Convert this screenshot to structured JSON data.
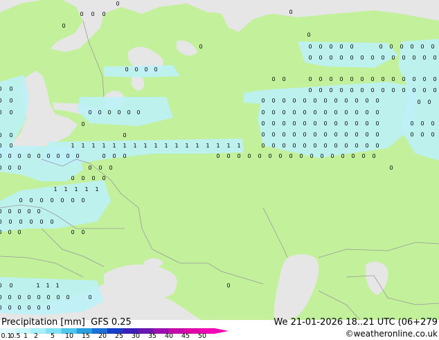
{
  "map": {
    "region": "Eastern Europe / Western Russia",
    "colors": {
      "land": "#c3f09a",
      "sea": "#e6e6e6",
      "border": "#9a9a9a",
      "precip_light": "#bdf1f7",
      "dot_outline": "#3a3a3a"
    },
    "precip_value_labels": [
      "0",
      "1"
    ]
  },
  "legend": {
    "title": "Precipitation [mm]",
    "model": "GFS 0.25",
    "valid_time": "We 21-01-2026 18..21 UTC (06+279",
    "credit": "©weatheronline.co.uk",
    "scale_values": [
      "0.1",
      "0.5",
      "1",
      "2",
      "5",
      "10",
      "15",
      "20",
      "25",
      "30",
      "35",
      "40",
      "45",
      "50"
    ],
    "scale_colors": [
      "#dffbff",
      "#c7f6fb",
      "#a8eef8",
      "#7fe1f1",
      "#4fc7ec",
      "#2a9ee0",
      "#1c6fd4",
      "#1740c6",
      "#3a1fb8",
      "#6a17b2",
      "#9a10ae",
      "#c40aa8",
      "#e006a6",
      "#f200b4"
    ]
  }
}
